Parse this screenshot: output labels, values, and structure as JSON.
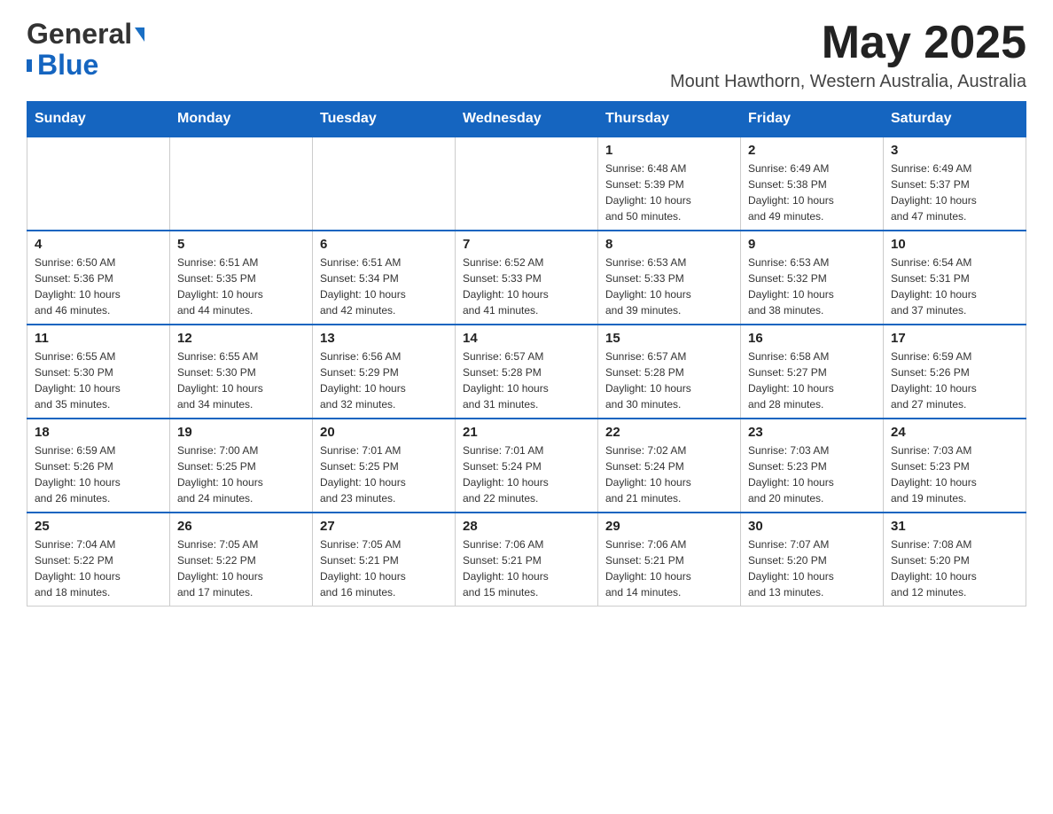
{
  "header": {
    "logo_general": "General",
    "logo_blue": "Blue",
    "month_title": "May 2025",
    "location": "Mount Hawthorn, Western Australia, Australia"
  },
  "weekdays": [
    "Sunday",
    "Monday",
    "Tuesday",
    "Wednesday",
    "Thursday",
    "Friday",
    "Saturday"
  ],
  "weeks": [
    [
      {
        "day": "",
        "info": ""
      },
      {
        "day": "",
        "info": ""
      },
      {
        "day": "",
        "info": ""
      },
      {
        "day": "",
        "info": ""
      },
      {
        "day": "1",
        "info": "Sunrise: 6:48 AM\nSunset: 5:39 PM\nDaylight: 10 hours\nand 50 minutes."
      },
      {
        "day": "2",
        "info": "Sunrise: 6:49 AM\nSunset: 5:38 PM\nDaylight: 10 hours\nand 49 minutes."
      },
      {
        "day": "3",
        "info": "Sunrise: 6:49 AM\nSunset: 5:37 PM\nDaylight: 10 hours\nand 47 minutes."
      }
    ],
    [
      {
        "day": "4",
        "info": "Sunrise: 6:50 AM\nSunset: 5:36 PM\nDaylight: 10 hours\nand 46 minutes."
      },
      {
        "day": "5",
        "info": "Sunrise: 6:51 AM\nSunset: 5:35 PM\nDaylight: 10 hours\nand 44 minutes."
      },
      {
        "day": "6",
        "info": "Sunrise: 6:51 AM\nSunset: 5:34 PM\nDaylight: 10 hours\nand 42 minutes."
      },
      {
        "day": "7",
        "info": "Sunrise: 6:52 AM\nSunset: 5:33 PM\nDaylight: 10 hours\nand 41 minutes."
      },
      {
        "day": "8",
        "info": "Sunrise: 6:53 AM\nSunset: 5:33 PM\nDaylight: 10 hours\nand 39 minutes."
      },
      {
        "day": "9",
        "info": "Sunrise: 6:53 AM\nSunset: 5:32 PM\nDaylight: 10 hours\nand 38 minutes."
      },
      {
        "day": "10",
        "info": "Sunrise: 6:54 AM\nSunset: 5:31 PM\nDaylight: 10 hours\nand 37 minutes."
      }
    ],
    [
      {
        "day": "11",
        "info": "Sunrise: 6:55 AM\nSunset: 5:30 PM\nDaylight: 10 hours\nand 35 minutes."
      },
      {
        "day": "12",
        "info": "Sunrise: 6:55 AM\nSunset: 5:30 PM\nDaylight: 10 hours\nand 34 minutes."
      },
      {
        "day": "13",
        "info": "Sunrise: 6:56 AM\nSunset: 5:29 PM\nDaylight: 10 hours\nand 32 minutes."
      },
      {
        "day": "14",
        "info": "Sunrise: 6:57 AM\nSunset: 5:28 PM\nDaylight: 10 hours\nand 31 minutes."
      },
      {
        "day": "15",
        "info": "Sunrise: 6:57 AM\nSunset: 5:28 PM\nDaylight: 10 hours\nand 30 minutes."
      },
      {
        "day": "16",
        "info": "Sunrise: 6:58 AM\nSunset: 5:27 PM\nDaylight: 10 hours\nand 28 minutes."
      },
      {
        "day": "17",
        "info": "Sunrise: 6:59 AM\nSunset: 5:26 PM\nDaylight: 10 hours\nand 27 minutes."
      }
    ],
    [
      {
        "day": "18",
        "info": "Sunrise: 6:59 AM\nSunset: 5:26 PM\nDaylight: 10 hours\nand 26 minutes."
      },
      {
        "day": "19",
        "info": "Sunrise: 7:00 AM\nSunset: 5:25 PM\nDaylight: 10 hours\nand 24 minutes."
      },
      {
        "day": "20",
        "info": "Sunrise: 7:01 AM\nSunset: 5:25 PM\nDaylight: 10 hours\nand 23 minutes."
      },
      {
        "day": "21",
        "info": "Sunrise: 7:01 AM\nSunset: 5:24 PM\nDaylight: 10 hours\nand 22 minutes."
      },
      {
        "day": "22",
        "info": "Sunrise: 7:02 AM\nSunset: 5:24 PM\nDaylight: 10 hours\nand 21 minutes."
      },
      {
        "day": "23",
        "info": "Sunrise: 7:03 AM\nSunset: 5:23 PM\nDaylight: 10 hours\nand 20 minutes."
      },
      {
        "day": "24",
        "info": "Sunrise: 7:03 AM\nSunset: 5:23 PM\nDaylight: 10 hours\nand 19 minutes."
      }
    ],
    [
      {
        "day": "25",
        "info": "Sunrise: 7:04 AM\nSunset: 5:22 PM\nDaylight: 10 hours\nand 18 minutes."
      },
      {
        "day": "26",
        "info": "Sunrise: 7:05 AM\nSunset: 5:22 PM\nDaylight: 10 hours\nand 17 minutes."
      },
      {
        "day": "27",
        "info": "Sunrise: 7:05 AM\nSunset: 5:21 PM\nDaylight: 10 hours\nand 16 minutes."
      },
      {
        "day": "28",
        "info": "Sunrise: 7:06 AM\nSunset: 5:21 PM\nDaylight: 10 hours\nand 15 minutes."
      },
      {
        "day": "29",
        "info": "Sunrise: 7:06 AM\nSunset: 5:21 PM\nDaylight: 10 hours\nand 14 minutes."
      },
      {
        "day": "30",
        "info": "Sunrise: 7:07 AM\nSunset: 5:20 PM\nDaylight: 10 hours\nand 13 minutes."
      },
      {
        "day": "31",
        "info": "Sunrise: 7:08 AM\nSunset: 5:20 PM\nDaylight: 10 hours\nand 12 minutes."
      }
    ]
  ]
}
